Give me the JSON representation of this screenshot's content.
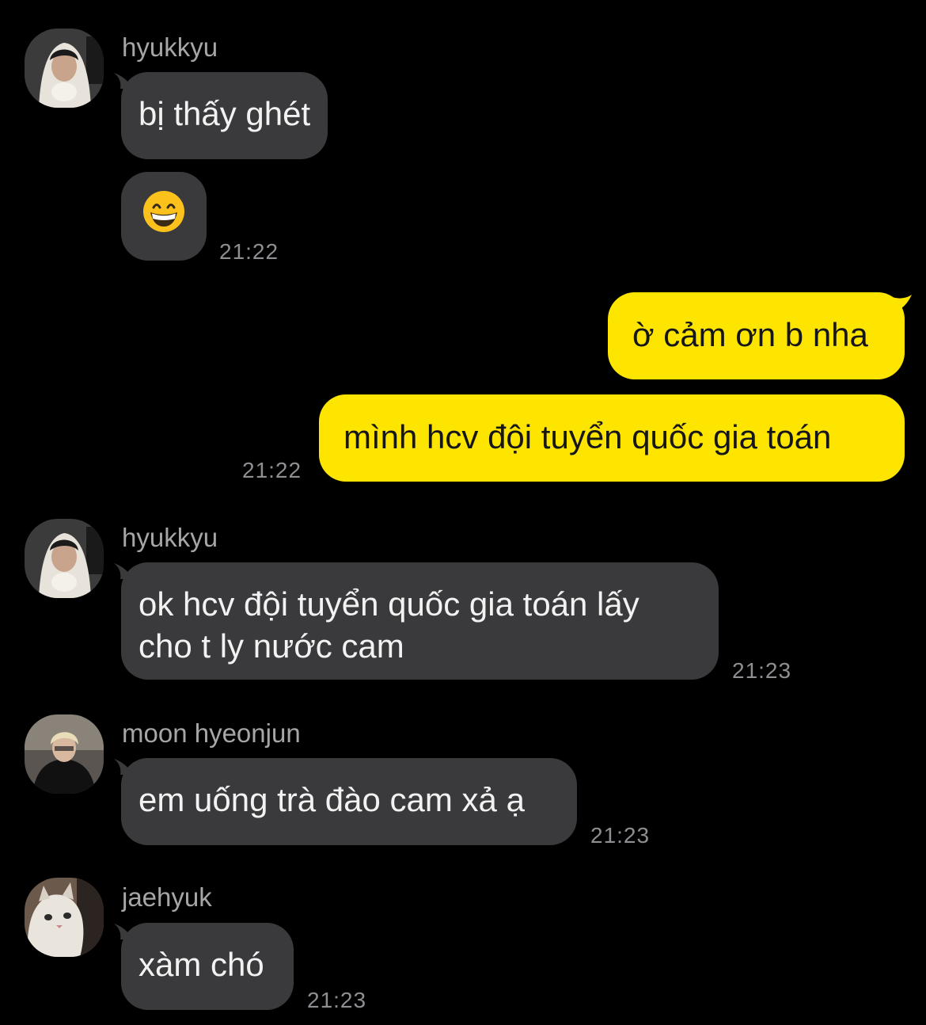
{
  "colors": {
    "background": "#000000",
    "incoming_bubble": "#3a3a3c",
    "outgoing_bubble": "#fee500",
    "timestamp": "#8e8e93"
  },
  "messages": [
    {
      "sender": "hyukkyu",
      "lines": [
        "bị thấy ghét"
      ]
    },
    {
      "sender": "hyukkyu",
      "emoji": "grinning-face-with-smiling-eyes",
      "time": "21:22"
    },
    {
      "sender": "me",
      "lines": [
        "ờ cảm ơn b nha"
      ]
    },
    {
      "sender": "me",
      "lines": [
        "mình hcv đội tuyển quốc gia toán"
      ],
      "time": "21:22"
    },
    {
      "sender": "hyukkyu",
      "lines": [
        "ok hcv đội tuyển quốc gia toán lấy",
        "cho t ly nước cam"
      ],
      "time": "21:23"
    },
    {
      "sender": "moon hyeonjun",
      "lines": [
        "em uống trà đào cam xả ạ"
      ],
      "time": "21:23"
    },
    {
      "sender": "jaehyuk",
      "lines": [
        "xàm chó"
      ],
      "time": "21:23"
    }
  ]
}
